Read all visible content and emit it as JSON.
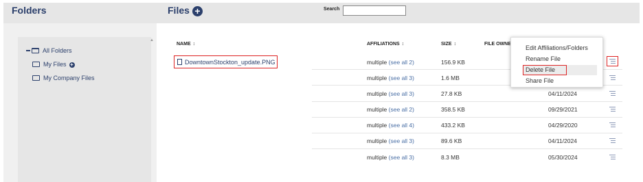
{
  "header": {
    "folders_title": "Folders",
    "files_title": "Files",
    "files_add_symbol": "+",
    "search_label": "Search",
    "search_value": ""
  },
  "tree": {
    "all_folders": "All Folders",
    "my_files": "My Files",
    "my_files_add": "+",
    "my_company_files": "My Company Files"
  },
  "columns": {
    "name": "NAME",
    "affiliations": "AFFILIATIONS",
    "size": "SIZE",
    "file_owner": "FILE OWNE",
    "sort_symbol": "↕"
  },
  "selected_file": {
    "name": "DowntownStockton_update.PNG"
  },
  "rows": [
    {
      "affil": "multiple",
      "see": "(see all 2)",
      "size": "156.9 KB",
      "date": ""
    },
    {
      "affil": "multiple",
      "see": "(see all 3)",
      "size": "1.6 MB",
      "date": ""
    },
    {
      "affil": "multiple",
      "see": "(see all 3)",
      "size": "27.8 KB",
      "date": "04/11/2024"
    },
    {
      "affil": "multiple",
      "see": "(see all 2)",
      "size": "358.5 KB",
      "date": "09/29/2021"
    },
    {
      "affil": "multiple",
      "see": "(see all 4)",
      "size": "433.2 KB",
      "date": "04/29/2020"
    },
    {
      "affil": "multiple",
      "see": "(see all 3)",
      "size": "89.6 KB",
      "date": "04/11/2024"
    },
    {
      "affil": "multiple",
      "see": "(see all 3)",
      "size": "8.3 MB",
      "date": "05/30/2024"
    }
  ],
  "context_menu": {
    "edit": "Edit Affiliations/Folders",
    "rename": "Rename File",
    "delete": "Delete File",
    "share": "Share File"
  },
  "icons": {
    "row_actions": "list-actions-icon",
    "file": "document-icon",
    "folder": "folder-icon"
  },
  "colors": {
    "brand": "#2b3f6b",
    "highlight": "#dd2222",
    "link": "#4a6fa5"
  }
}
